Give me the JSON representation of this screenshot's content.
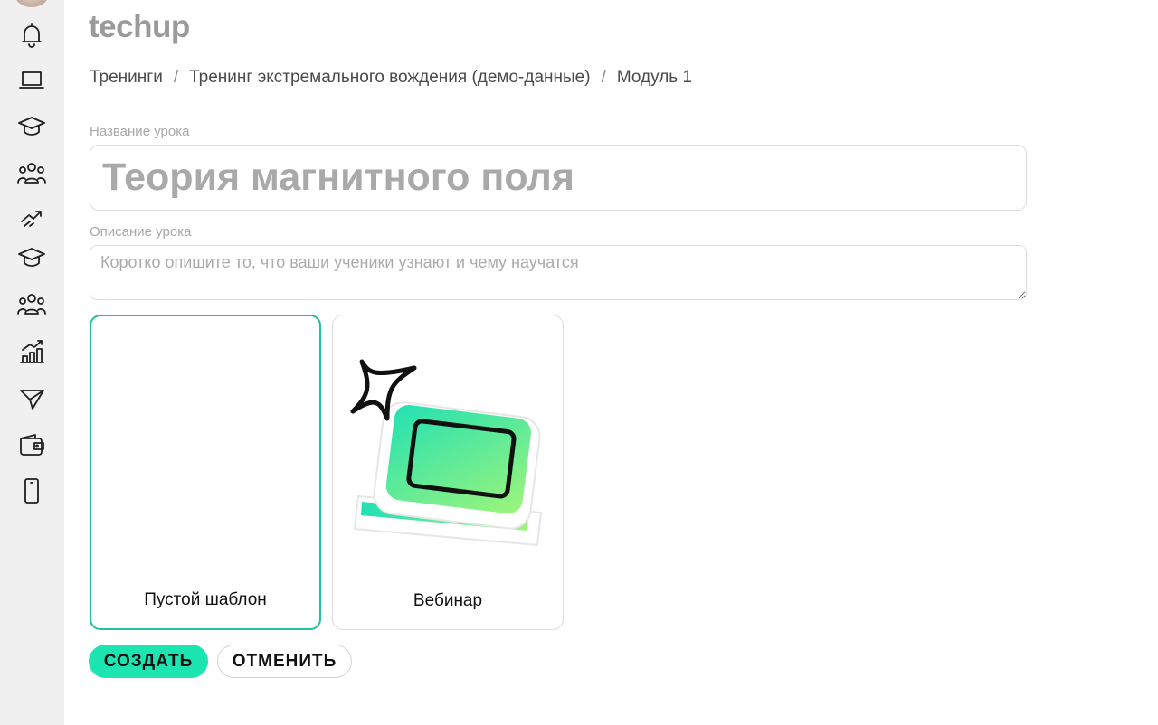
{
  "app": {
    "logo": "techup"
  },
  "sidebar": {
    "icons": [
      "bell-icon",
      "laptop-icon",
      "graduation-cap-icon",
      "users-icon",
      "trend-icon",
      "graduation-cap-icon",
      "users-icon",
      "analytics-icon",
      "send-icon",
      "wallet-icon",
      "mobile-icon"
    ]
  },
  "breadcrumb": {
    "items": [
      "Тренинги",
      "Тренинг экстремального вождения (демо-данные)",
      "Модуль 1"
    ],
    "separator": "/"
  },
  "form": {
    "title_label": "Название урока",
    "title_placeholder": "Теория магнитного поля",
    "title_value": "",
    "description_label": "Описание урока",
    "description_placeholder": "Коротко опишите то, что ваши ученики узнают и чему научатся",
    "description_value": ""
  },
  "templates": [
    {
      "label": "Пустой шаблон",
      "selected": true
    },
    {
      "label": "Вебинар",
      "selected": false
    }
  ],
  "actions": {
    "create_label": "СОЗДАТЬ",
    "cancel_label": "ОТМЕНИТЬ"
  },
  "colors": {
    "accent": "#1de5b1",
    "selected_border": "#1fc29a",
    "sidebar_bg": "#f0f0f0"
  }
}
